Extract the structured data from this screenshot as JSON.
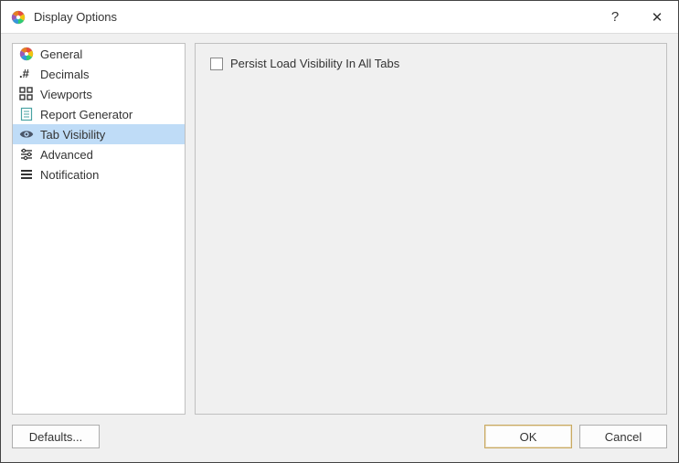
{
  "window": {
    "title": "Display Options"
  },
  "sidebar": {
    "items": [
      {
        "id": "general",
        "label": "General",
        "selected": false
      },
      {
        "id": "decimals",
        "label": "Decimals",
        "selected": false
      },
      {
        "id": "viewports",
        "label": "Viewports",
        "selected": false
      },
      {
        "id": "report-generator",
        "label": "Report Generator",
        "selected": false
      },
      {
        "id": "tab-visibility",
        "label": "Tab Visibility",
        "selected": true
      },
      {
        "id": "advanced",
        "label": "Advanced",
        "selected": false
      },
      {
        "id": "notification",
        "label": "Notification",
        "selected": false
      }
    ]
  },
  "content": {
    "persist_checkbox_label": "Persist Load Visibility In All Tabs",
    "persist_checkbox_checked": false
  },
  "footer": {
    "defaults_label": "Defaults...",
    "ok_label": "OK",
    "cancel_label": "Cancel"
  },
  "titlebar": {
    "help_symbol": "?",
    "close_symbol": "✕"
  }
}
